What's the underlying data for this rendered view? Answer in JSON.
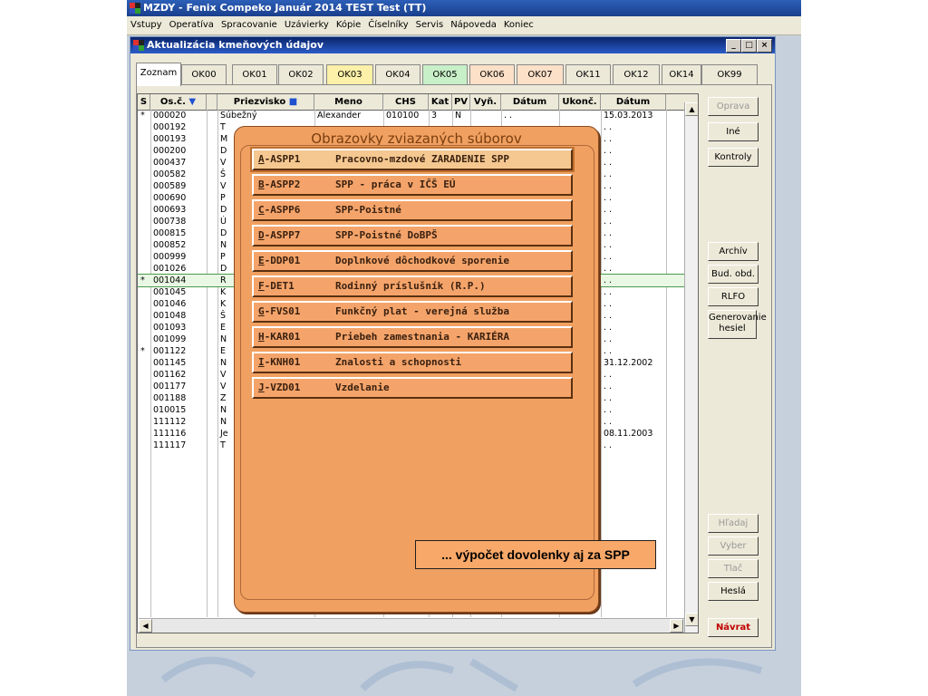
{
  "titlebar": {
    "title": "MZDY - Fenix Compeko Január 2014   TEST Test (TT)"
  },
  "menu": [
    "Vstupy",
    "Operatíva",
    "Spracovanie",
    "Uzávierky",
    "Kópie",
    "Číselníky",
    "Servis",
    "Nápoveda",
    "Koniec"
  ],
  "window": {
    "title": "Aktualizácia kmeňových údajov",
    "min": "_",
    "max": "□",
    "close": "×"
  },
  "tabs": [
    "Zoznam",
    "OK00",
    "OK01",
    "OK02",
    "OK03",
    "OK04",
    "OK05",
    "OK06",
    "OK07",
    "OK11",
    "OK12",
    "OK14",
    "OK99"
  ],
  "tab_colors": {
    "OK03": "#fdf0a8",
    "OK05": "#c8f0c8",
    "OK06": "#fde0c8",
    "OK07": "#fde0c8"
  },
  "columns": {
    "s": "S",
    "osc": "Os.č.",
    "priezvisko": "Priezvisko",
    "meno": "Meno",
    "chs": "CHS",
    "kat": "Kat",
    "pv": "PV",
    "vyn": "Vyň.",
    "datum1": "Dátum",
    "ukonc": "Ukonč.",
    "datum2": "Dátum"
  },
  "rows": [
    {
      "s": "*",
      "osc": "000020",
      "pr": "Súbežný",
      "meno": "Alexander",
      "chs": "010100",
      "kat": "3",
      "pv": "N",
      "d1": ". .",
      "d2": "15.03.2013"
    },
    {
      "s": "",
      "osc": "000192",
      "pr": "T",
      "d2": ". ."
    },
    {
      "s": "",
      "osc": "000193",
      "pr": "M",
      "d2": ". ."
    },
    {
      "s": "",
      "osc": "000200",
      "pr": "D",
      "d2": ". ."
    },
    {
      "s": "",
      "osc": "000437",
      "pr": "V",
      "d2": ". ."
    },
    {
      "s": "",
      "osc": "000582",
      "pr": "Š",
      "d2": ". ."
    },
    {
      "s": "",
      "osc": "000589",
      "pr": "V",
      "d2": ". ."
    },
    {
      "s": "",
      "osc": "000690",
      "pr": "P",
      "d2": ". ."
    },
    {
      "s": "",
      "osc": "000693",
      "pr": "D",
      "d2": ". ."
    },
    {
      "s": "",
      "osc": "000738",
      "pr": "Ú",
      "d2": ". ."
    },
    {
      "s": "",
      "osc": "000815",
      "pr": "D",
      "d2": ". ."
    },
    {
      "s": "",
      "osc": "000852",
      "pr": "N",
      "d2": ". ."
    },
    {
      "s": "",
      "osc": "000999",
      "pr": "P",
      "d2": ". ."
    },
    {
      "s": "",
      "osc": "001026",
      "pr": "D",
      "d2": ". ."
    },
    {
      "s": "*",
      "osc": "001044",
      "pr": "R",
      "d2": ". .",
      "sel": true
    },
    {
      "s": "",
      "osc": "001045",
      "pr": "K",
      "d2": ". ."
    },
    {
      "s": "",
      "osc": "001046",
      "pr": "K",
      "d2": ". ."
    },
    {
      "s": "",
      "osc": "001048",
      "pr": "Š",
      "d2": ". ."
    },
    {
      "s": "",
      "osc": "001093",
      "pr": "E",
      "d2": ". ."
    },
    {
      "s": "",
      "osc": "001099",
      "pr": "N",
      "d2": ". ."
    },
    {
      "s": "*",
      "osc": "001122",
      "pr": "E",
      "d2": ". ."
    },
    {
      "s": "",
      "osc": "001145",
      "pr": "N",
      "d2": "31.12.2002"
    },
    {
      "s": "",
      "osc": "001162",
      "pr": "V",
      "d2": ". ."
    },
    {
      "s": "",
      "osc": "001177",
      "pr": "V",
      "d2": ". ."
    },
    {
      "s": "",
      "osc": "001188",
      "pr": "Z",
      "d2": ". ."
    },
    {
      "s": "",
      "osc": "010015",
      "pr": "N",
      "d2": ". ."
    },
    {
      "s": "",
      "osc": "111112",
      "pr": "N",
      "d2": ". ."
    },
    {
      "s": "",
      "osc": "111116",
      "pr": "Je",
      "d2": "08.11.2003"
    },
    {
      "s": "",
      "osc": "111117",
      "pr": "T",
      "d2": ". ."
    }
  ],
  "side_buttons_top": [
    {
      "label": "Oprava",
      "disabled": true
    },
    {
      "label": "Iné",
      "disabled": false
    },
    {
      "label": "Kontroly",
      "disabled": false
    }
  ],
  "side_buttons_mid": [
    {
      "label": "Archív",
      "disabled": false
    },
    {
      "label": "Bud. obd.",
      "disabled": false
    },
    {
      "label": "RLFO",
      "disabled": false
    },
    {
      "label": "Generovanie hesiel",
      "disabled": false
    }
  ],
  "side_buttons_bottom": [
    {
      "label": "Hľadaj",
      "disabled": true
    },
    {
      "label": "Vyber",
      "disabled": true
    },
    {
      "label": "Tlač",
      "disabled": true
    },
    {
      "label": "Heslá",
      "disabled": false
    }
  ],
  "navrat": "Návrat",
  "popup": {
    "title": "Obrazovky zviazaných súborov",
    "items": [
      {
        "key": "A",
        "code": "-ASPP1",
        "desc": "Pracovno-mzdové  ZARADENIE SPP",
        "active": true
      },
      {
        "key": "B",
        "code": "-ASPP2",
        "desc": "SPP - práca v IČŠ EÚ"
      },
      {
        "key": "C",
        "code": "-ASPP6",
        "desc": "SPP-Poistné"
      },
      {
        "key": "D",
        "code": "-ASPP7",
        "desc": "SPP-Poistné DoBPŠ"
      },
      {
        "key": "E",
        "code": "-DDP01",
        "desc": "Doplnkové dôchodkové sporenie"
      },
      {
        "key": "F",
        "code": "-DET1",
        "desc": "Rodinný príslušník (R.P.)"
      },
      {
        "key": "G",
        "code": "-FVS01",
        "desc": "Funkčný plat - verejná služba"
      },
      {
        "key": "H",
        "code": "-KAR01",
        "desc": "Priebeh zamestnania - KARIÉRA"
      },
      {
        "key": "I",
        "code": "-KNH01",
        "desc": "Znalosti a schopnosti"
      },
      {
        "key": "J",
        "code": "-VZD01",
        "desc": "Vzdelanie"
      }
    ]
  },
  "note": "... výpočet dovolenky aj za SPP"
}
